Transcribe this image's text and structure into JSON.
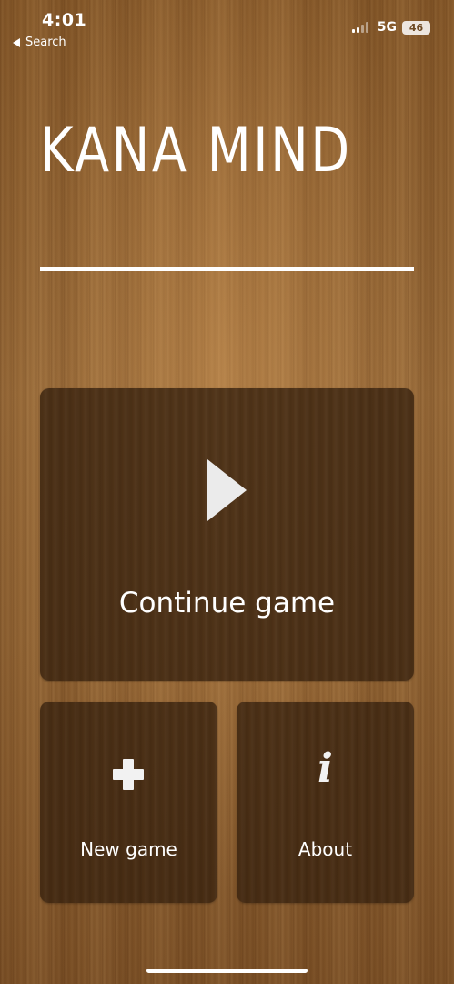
{
  "status_bar": {
    "time": "4:01",
    "back_label": "Search",
    "network": "5G",
    "battery": "46",
    "icons": [
      "signal-icon",
      "battery-icon",
      "back-arrow-icon"
    ]
  },
  "app": {
    "title": "KANA MIND"
  },
  "menu": {
    "continue_label": "Continue game",
    "new_game_label": "New game",
    "about_label": "About",
    "about_glyph": "i",
    "icons": [
      "play-icon",
      "plus-icon",
      "info-icon"
    ]
  },
  "colors": {
    "background_wood": "#8c5f31",
    "tile": "#3a230f",
    "text": "#ffffff"
  }
}
